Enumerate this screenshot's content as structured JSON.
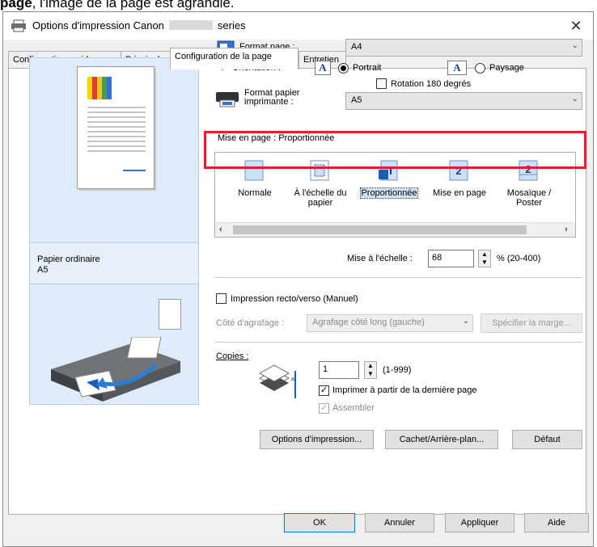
{
  "caption": {
    "bold": "page",
    "rest": ", l'image de la page est agrandie."
  },
  "window": {
    "title_prefix": "Options d'impression Canon",
    "title_suffix": "series",
    "close_glyph": "✕"
  },
  "tabs": [
    {
      "label": "Configuration rapide",
      "active": false
    },
    {
      "label": "Principal",
      "active": false
    },
    {
      "label": "Configuration de la page",
      "active": true
    },
    {
      "label": "Entretien",
      "active": false
    }
  ],
  "preview": {
    "media_type": "Papier ordinaire",
    "paper_size": "A5"
  },
  "page_size": {
    "label": "Format page :",
    "value": "A4"
  },
  "orientation": {
    "label": "Orientation :",
    "portrait": "Portrait",
    "landscape": "Paysage",
    "selected": "portrait"
  },
  "rotate180": {
    "label": "Rotation 180 degrés",
    "checked": false
  },
  "printer_paper": {
    "label_line1": "Format papier",
    "label_line2": "imprimante :",
    "value": "A5"
  },
  "layout": {
    "label": "Mise en page :",
    "current": "Proportionnée",
    "items": [
      {
        "label": "Normale"
      },
      {
        "label_line1": "À l'échelle du",
        "label_line2": "papier"
      },
      {
        "label": "Proportionnée"
      },
      {
        "label": "Mise en page"
      },
      {
        "label_line1": "Mosaïque /",
        "label_line2": "Poster"
      }
    ]
  },
  "scaling": {
    "label": "Mise à l'échelle :",
    "value": "68",
    "range": "% (20-400)"
  },
  "duplex": {
    "label": "Impression recto/verso (Manuel)",
    "checked": false
  },
  "stapling": {
    "label": "Côté d'agrafage :",
    "value": "Agrafage côté long (gauche)",
    "margin_button": "Spécifier la marge..."
  },
  "copies": {
    "label": "Copies :",
    "value": "1",
    "range": "(1-999)",
    "last_page_first": "Imprimer à partir de la dernière page",
    "last_page_first_checked": true,
    "collate": "Assembler",
    "collate_checked": true
  },
  "actions": {
    "print_options": "Options d'impression...",
    "stamp_background": "Cachet/Arrière-plan...",
    "defaults": "Défaut"
  },
  "footer": {
    "ok": "OK",
    "cancel": "Annuler",
    "apply": "Appliquer",
    "help": "Aide"
  },
  "colors": {
    "highlight": "#e0202a",
    "preview_panel": "#deebf8",
    "accent_blue": "#1a5fb4"
  }
}
